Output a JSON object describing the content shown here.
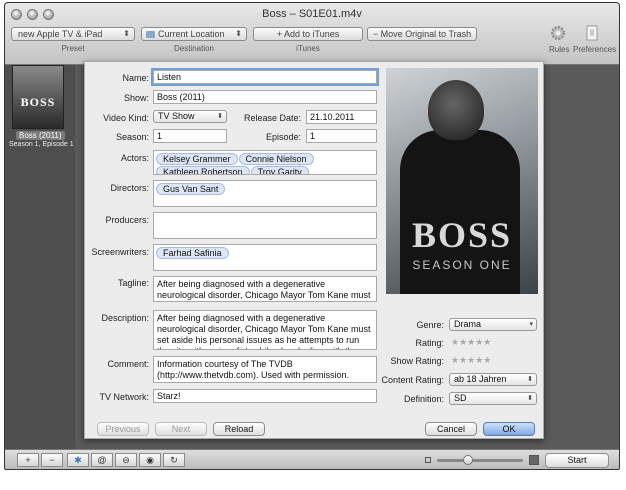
{
  "window": {
    "title": "Boss – S01E01.m4v"
  },
  "toolbar": {
    "preset_value": "new Apple TV & iPad",
    "preset_label": "Preset",
    "destination_value": "Current Location",
    "destination_label": "Destination",
    "itunes_button": "Add to iTunes",
    "itunes_label": "iTunes",
    "trash_button": "Move Original to Trash",
    "rules_label": "Rules",
    "preferences_label": "Preferences"
  },
  "sidebar": {
    "thumb_text": "BOSS",
    "item_title": "Boss (2011)",
    "item_subtitle": "Season 1, Episode 1"
  },
  "form": {
    "name_label": "Name:",
    "name_value": "Listen",
    "show_label": "Show:",
    "show_value": "Boss (2011)",
    "video_kind_label": "Video Kind:",
    "video_kind_value": "TV Show",
    "release_date_label": "Release Date:",
    "release_date_value": "21.10.2011",
    "season_label": "Season:",
    "season_value": "1",
    "episode_label": "Episode:",
    "episode_value": "1",
    "actors_label": "Actors:",
    "actors": [
      "Kelsey Grammer",
      "Connie Nielson",
      "Kathleen Robertson",
      "Troy Garity"
    ],
    "directors_label": "Directors:",
    "directors": [
      "Gus Van Sant"
    ],
    "producers_label": "Producers:",
    "screenwriters_label": "Screenwriters:",
    "screenwriters": [
      "Farhad Safinia"
    ],
    "tagline_label": "Tagline:",
    "tagline_value": "After being diagnosed with a degenerative neurological disorder, Chicago Mayor Tom Kane must set aside his",
    "description_label": "Description:",
    "description_value": "After being diagnosed with a degenerative neurological disorder, Chicago Mayor Tom Kane must set aside his personal issues as he attempts to run the city with an iron fist, while also dealing with the upcoming",
    "comment_label": "Comment:",
    "comment_value": "Information courtesy of The TVDB (http://www.thetvdb.com). Used with permission.",
    "tv_network_label": "TV Network:",
    "tv_network_value": "Starz!",
    "genre_label": "Genre:",
    "genre_value": "Drama",
    "rating_label": "Rating:",
    "rating_stars": "★★★★★",
    "show_rating_label": "Show Rating:",
    "show_rating_stars": "★★★★★",
    "content_rating_label": "Content Rating:",
    "content_rating_value": "ab 18 Jahren",
    "definition_label": "Definition:",
    "definition_value": "SD"
  },
  "poster": {
    "title": "BOSS",
    "subtitle": "SEASON ONE"
  },
  "buttons": {
    "previous": "Previous",
    "next": "Next",
    "reload": "Reload",
    "cancel": "Cancel",
    "ok": "OK"
  },
  "bottom": {
    "start": "Start"
  },
  "colors": {
    "accent_focus": "#6fa0dc",
    "token_bg": "#dce6f6",
    "default_button": "#7fa9e3"
  }
}
